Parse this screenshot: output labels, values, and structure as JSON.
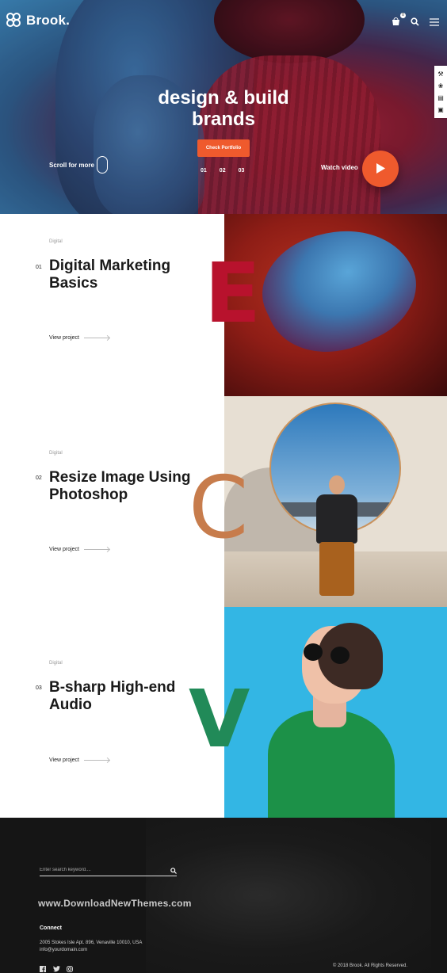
{
  "header": {
    "logo_text": "Brook.",
    "cart_count": "0",
    "icons": [
      "cart-icon",
      "search-icon",
      "menu-icon"
    ]
  },
  "side_toolbar": {
    "icons": [
      "wrench-icon",
      "lifebuoy-icon",
      "document-icon",
      "cart-icon"
    ]
  },
  "hero": {
    "title_line1": "design & build",
    "title_line2": "brands",
    "cta_label": "Check Portfolio",
    "scroll_label": "Scroll for more",
    "slides": [
      "01",
      "02",
      "03"
    ],
    "watch_label": "Watch video",
    "accent": "#ef5a2d"
  },
  "projects": [
    {
      "category": "Digital",
      "number": "01",
      "title": "Digital Marketing Basics",
      "link_label": "View project",
      "letter": "E",
      "letter_color": "#b8122d"
    },
    {
      "category": "Digital",
      "number": "02",
      "title": "Resize Image Using Photoshop",
      "link_label": "View project",
      "letter": "C",
      "letter_color": "#c77c4c"
    },
    {
      "category": "Digital",
      "number": "03",
      "title": "B-sharp High-end Audio",
      "link_label": "View project",
      "letter": "V",
      "letter_color": "#218a58"
    }
  ],
  "footer": {
    "search_placeholder": "Enter search keyword....",
    "watermark": "www.DownloadNewThemes.com",
    "connect_title": "Connect",
    "address": "2005 Stokes Isle Apt. 896, Venaville 10010, USA",
    "email": "info@yourdomain.com",
    "social_icons": [
      "facebook-icon",
      "twitter-icon",
      "instagram-icon"
    ],
    "copyright": "© 2018 Brook. All Rights Reserved."
  }
}
